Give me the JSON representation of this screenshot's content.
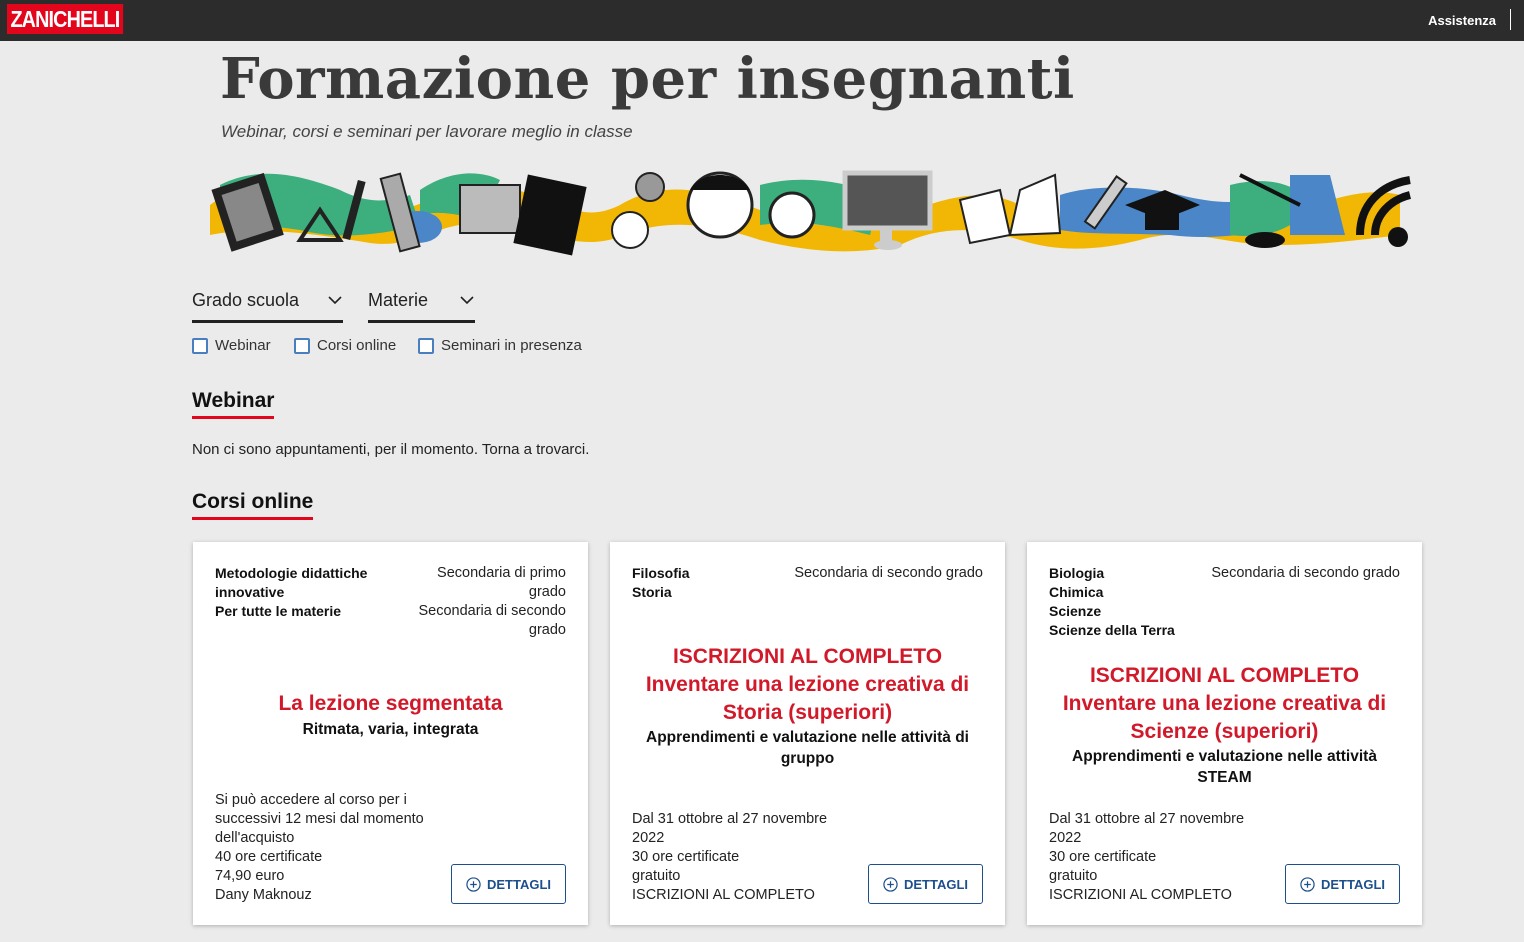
{
  "header": {
    "logo": "ZANICHELLI",
    "assist_link": "Assistenza"
  },
  "hero": {
    "title": "Formazione per insegnanti",
    "subtitle": "Webinar, corsi e seminari per lavorare meglio in classe"
  },
  "filters": {
    "selects": [
      {
        "label": "Grado scuola"
      },
      {
        "label": "Materie"
      }
    ],
    "checkboxes": [
      {
        "label": "Webinar",
        "checked": false
      },
      {
        "label": "Corsi online",
        "checked": false
      },
      {
        "label": "Seminari in presenza",
        "checked": false
      }
    ]
  },
  "sections": {
    "webinar": {
      "title": "Webinar",
      "empty_message": "Non ci sono appuntamenti, per il momento. Torna a trovarci."
    },
    "corsi": {
      "title": "Corsi online"
    }
  },
  "cards": [
    {
      "subjects": [
        "Metodologie didattiche innovative",
        "Per tutte le materie"
      ],
      "grades": [
        "Secondaria di primo grado",
        "Secondaria di secondo grado"
      ],
      "title_lines": [
        "La lezione segmentata"
      ],
      "subtitle": "Ritmata, varia, integrata",
      "info": [
        "Si può accedere al corso per i successivi 12 mesi dal momento dell'acquisto",
        "40 ore certificate",
        "74,90 euro",
        "Dany Maknouz"
      ],
      "button": "DETTAGLI"
    },
    {
      "subjects": [
        "Filosofia",
        "Storia"
      ],
      "grades": [
        "Secondaria di secondo grado"
      ],
      "title_lines": [
        "ISCRIZIONI AL COMPLETO",
        "Inventare una lezione creativa di Storia (superiori)"
      ],
      "subtitle": "Apprendimenti e valutazione nelle attività di gruppo",
      "info": [
        "Dal 31 ottobre al 27 novembre 2022",
        "30 ore certificate",
        "gratuito",
        "ISCRIZIONI AL COMPLETO"
      ],
      "button": "DETTAGLI"
    },
    {
      "subjects": [
        "Biologia",
        "Chimica",
        "Scienze",
        "Scienze della Terra"
      ],
      "grades": [
        "Secondaria di secondo grado"
      ],
      "title_lines": [
        "ISCRIZIONI AL COMPLETO",
        "Inventare una lezione creativa di Scienze (superiori)"
      ],
      "subtitle": "Apprendimenti e valutazione nelle attività STEAM",
      "info": [
        "Dal 31 ottobre al 27 novembre 2022",
        "30 ore certificate",
        "gratuito",
        "ISCRIZIONI AL COMPLETO"
      ],
      "button": "DETTAGLI"
    }
  ],
  "colors": {
    "brand_red": "#e3051b",
    "title_red": "#d1192a",
    "button_blue": "#1c4f8c",
    "banner_green": "#3dae7e",
    "banner_yellow": "#f2b705",
    "banner_blue": "#4a86c8"
  }
}
